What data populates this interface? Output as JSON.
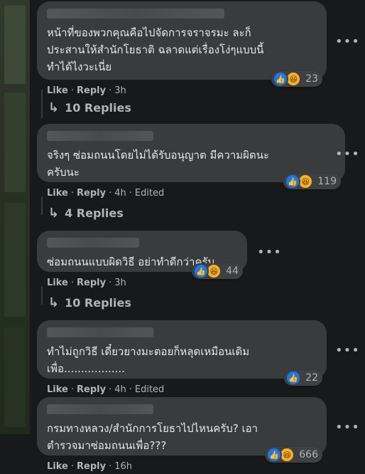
{
  "comments": [
    {
      "text": "หน้าที่ของพวกคุณคือไปจัดการจราจรมะ ละก็\nประสานให้สำนักโยธาติ ฉลาดแต่เรื่องโง่ๆแบบนี้\nทำได้ไงวะเนี่ย",
      "reaction_count": "23",
      "like": "Like",
      "reply": "Reply",
      "time": "3h",
      "edited": "",
      "replies": "10 Replies"
    },
    {
      "text": "จริงๆ ซ่อมถนนโดยไม่ได้รับอนุญาต มีความผิดนะ\nครับนะ",
      "reaction_count": "119",
      "like": "Like",
      "reply": "Reply",
      "time": "4h",
      "edited": "Edited",
      "replies": "4 Replies"
    },
    {
      "text": "ซ่อมถนนแบบผิดวิธี อย่าทำดีกว่าครับ",
      "reaction_count": "44",
      "like": "Like",
      "reply": "Reply",
      "time": "3h",
      "edited": "",
      "replies": "10 Replies"
    },
    {
      "text": "ทำไม่ถูกวิธี เดี๋ยวยางมะตอยก็หลุดเหมือนเดิม\nเพื่อ..................",
      "reaction_count": "22",
      "like": "Like",
      "reply": "Reply",
      "time": "4h",
      "edited": "Edited",
      "replies": ""
    },
    {
      "text": "กรมทางหลวง/สำนักการโยธาไปไหนครับ? เอา\nตำรวจมาซ่อมถนนเพื่อ???",
      "reaction_count": "666",
      "like": "Like",
      "reply": "Reply",
      "time": "16h",
      "edited": "",
      "replies": ""
    }
  ],
  "ui": {
    "dot": "·",
    "more": "•••",
    "reply_arrow": "↳"
  },
  "colors": {
    "background": "#18191a",
    "bubble": "#3a3b3c",
    "like_blue": "#1877f2",
    "haha_yellow": "#f7b125"
  }
}
